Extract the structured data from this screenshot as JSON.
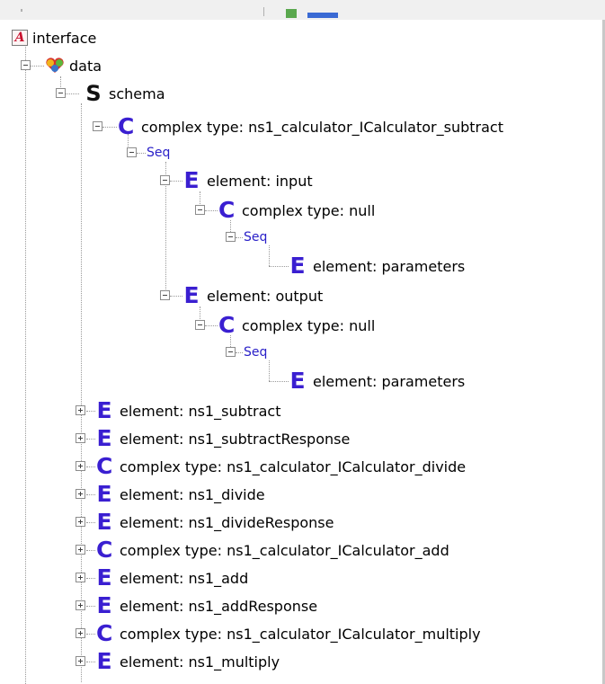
{
  "colors": {
    "element_icon": "#3a1fd1",
    "schema_icon": "#111111",
    "seq_text": "#2a20c8",
    "interface_icon": "#c8102e"
  },
  "tree": {
    "interface": {
      "label": "interface",
      "icon": "interface-icon"
    },
    "data": {
      "label": "data",
      "icon": "data-icon",
      "expanded": true
    },
    "schema": {
      "label": "schema",
      "icon": "schema-icon",
      "glyph": "S",
      "expanded": true
    },
    "ct_subtract": {
      "label": "complex type: ns1_calculator_ICalculator_subtract",
      "glyph": "C",
      "expanded": true
    },
    "seq1": {
      "label": "Seq"
    },
    "el_input": {
      "label": "element: input",
      "glyph": "E",
      "expanded": true
    },
    "ct_null1": {
      "label": "complex type: null",
      "glyph": "C",
      "expanded": true
    },
    "seq2": {
      "label": "Seq"
    },
    "el_params1": {
      "label": "element: parameters",
      "glyph": "E"
    },
    "el_output": {
      "label": "element: output",
      "glyph": "E",
      "expanded": true
    },
    "ct_null2": {
      "label": "complex type: null",
      "glyph": "C",
      "expanded": true
    },
    "seq3": {
      "label": "Seq"
    },
    "el_params2": {
      "label": "element: parameters",
      "glyph": "E"
    },
    "collapsed": [
      {
        "label": "element: ns1_subtract",
        "glyph": "E"
      },
      {
        "label": "element: ns1_subtractResponse",
        "glyph": "E"
      },
      {
        "label": "complex type: ns1_calculator_ICalculator_divide",
        "glyph": "C"
      },
      {
        "label": "element: ns1_divide",
        "glyph": "E"
      },
      {
        "label": "element: ns1_divideResponse",
        "glyph": "E"
      },
      {
        "label": "complex type: ns1_calculator_ICalculator_add",
        "glyph": "C"
      },
      {
        "label": "element: ns1_add",
        "glyph": "E"
      },
      {
        "label": "element: ns1_addResponse",
        "glyph": "E"
      },
      {
        "label": "complex type: ns1_calculator_ICalculator_multiply",
        "glyph": "C"
      },
      {
        "label": "element: ns1_multiply",
        "glyph": "E"
      }
    ]
  }
}
